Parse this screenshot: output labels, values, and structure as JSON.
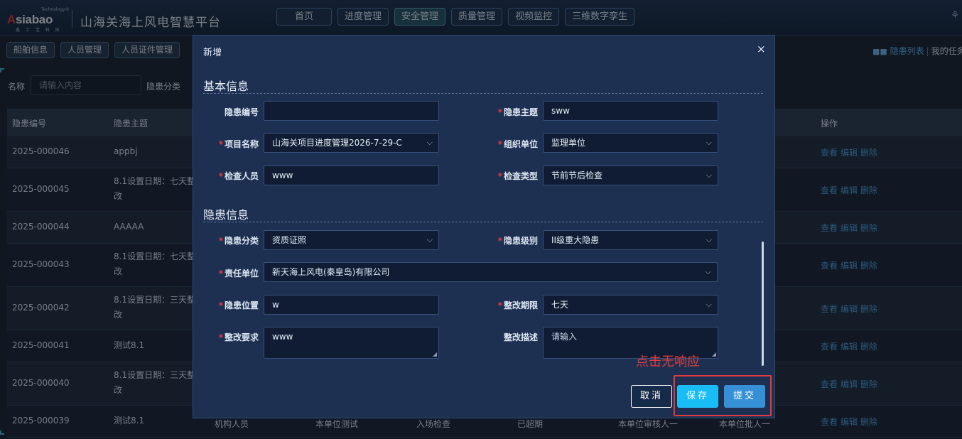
{
  "header": {
    "logo": {
      "trademark": "Technology®",
      "brand_prefix": "A",
      "brand_rest": "siabao",
      "sub": "鑫 士 宝 科 技"
    },
    "app_title": "山海关海上风电智慧平台",
    "nav": [
      "首页",
      "进度管理",
      "安全管理",
      "质量管理",
      "视频监控",
      "三维数字孪生"
    ],
    "active_nav": "安全管理"
  },
  "subnav": [
    "船舶信息",
    "人员管理",
    "人员证件管理"
  ],
  "view_links": {
    "list": "隐患列表",
    "divider": "|",
    "tasks": "我的任务"
  },
  "filter": {
    "name_label": "名称",
    "name_placeholder": "请输入内容",
    "category_label": "隐患分类"
  },
  "table": {
    "columns": [
      "隐患编号",
      "隐患主题",
      "操作"
    ],
    "rows": [
      {
        "id": "2025-000046",
        "topic_line1": "appbj",
        "topic_line2": ""
      },
      {
        "id": "2025-000045",
        "topic_line1": "8.1设置日期：七天整",
        "topic_line2": "改"
      },
      {
        "id": "2025-000044",
        "topic_line1": "AAAAA",
        "topic_line2": ""
      },
      {
        "id": "2025-000043",
        "topic_line1": "8.1设置日期：七天整",
        "topic_line2": "改"
      },
      {
        "id": "2025-000042",
        "topic_line1": "8.1设置日期：三天整",
        "topic_line2": "改"
      },
      {
        "id": "2025-000041",
        "topic_line1": "测试8.1",
        "topic_line2": ""
      },
      {
        "id": "2025-000040",
        "topic_line1": "8.1设置日期：三天整",
        "topic_line2": "改"
      },
      {
        "id": "2025-000039",
        "topic_line1": "测试8.1",
        "topic_line2": ""
      }
    ],
    "last_row_partial": [
      "机构人员",
      "本单位测试",
      "入场检查",
      "已超期",
      "本单位审核人一",
      "本单位批人一"
    ],
    "ops": {
      "view": "查看",
      "edit": "编辑",
      "delete": "删除"
    }
  },
  "modal": {
    "title": "新增",
    "close": "×",
    "section_basic": "基本信息",
    "section_hazard": "隐患信息",
    "fields": {
      "hazard_no": {
        "label": "隐患编号",
        "value": ""
      },
      "hazard_topic": {
        "label": "隐患主题",
        "value": "sww"
      },
      "project_name": {
        "label": "项目名称",
        "value": "山海关项目进度管理2026-7-29-C"
      },
      "org_unit": {
        "label": "组织单位",
        "value": "监理单位"
      },
      "inspector": {
        "label": "检查人员",
        "value": "www"
      },
      "inspect_type": {
        "label": "检查类型",
        "value": "节前节后检查"
      },
      "hazard_category": {
        "label": "隐患分类",
        "value": "资质证照"
      },
      "hazard_level": {
        "label": "隐患级别",
        "value": "II级重大隐患"
      },
      "resp_unit": {
        "label": "责任单位",
        "value": "新天海上风电(秦皇岛)有限公司"
      },
      "hazard_location": {
        "label": "隐患位置",
        "value": "w"
      },
      "rectify_deadline": {
        "label": "整改期限",
        "value": "七天"
      },
      "rectify_req": {
        "label": "整改要求",
        "value": "www"
      },
      "rectify_desc": {
        "label": "整改描述",
        "placeholder": "请输入"
      }
    },
    "buttons": {
      "cancel": "取消",
      "save": "保存",
      "submit": "提交"
    }
  },
  "annotation": "点击无响应"
}
